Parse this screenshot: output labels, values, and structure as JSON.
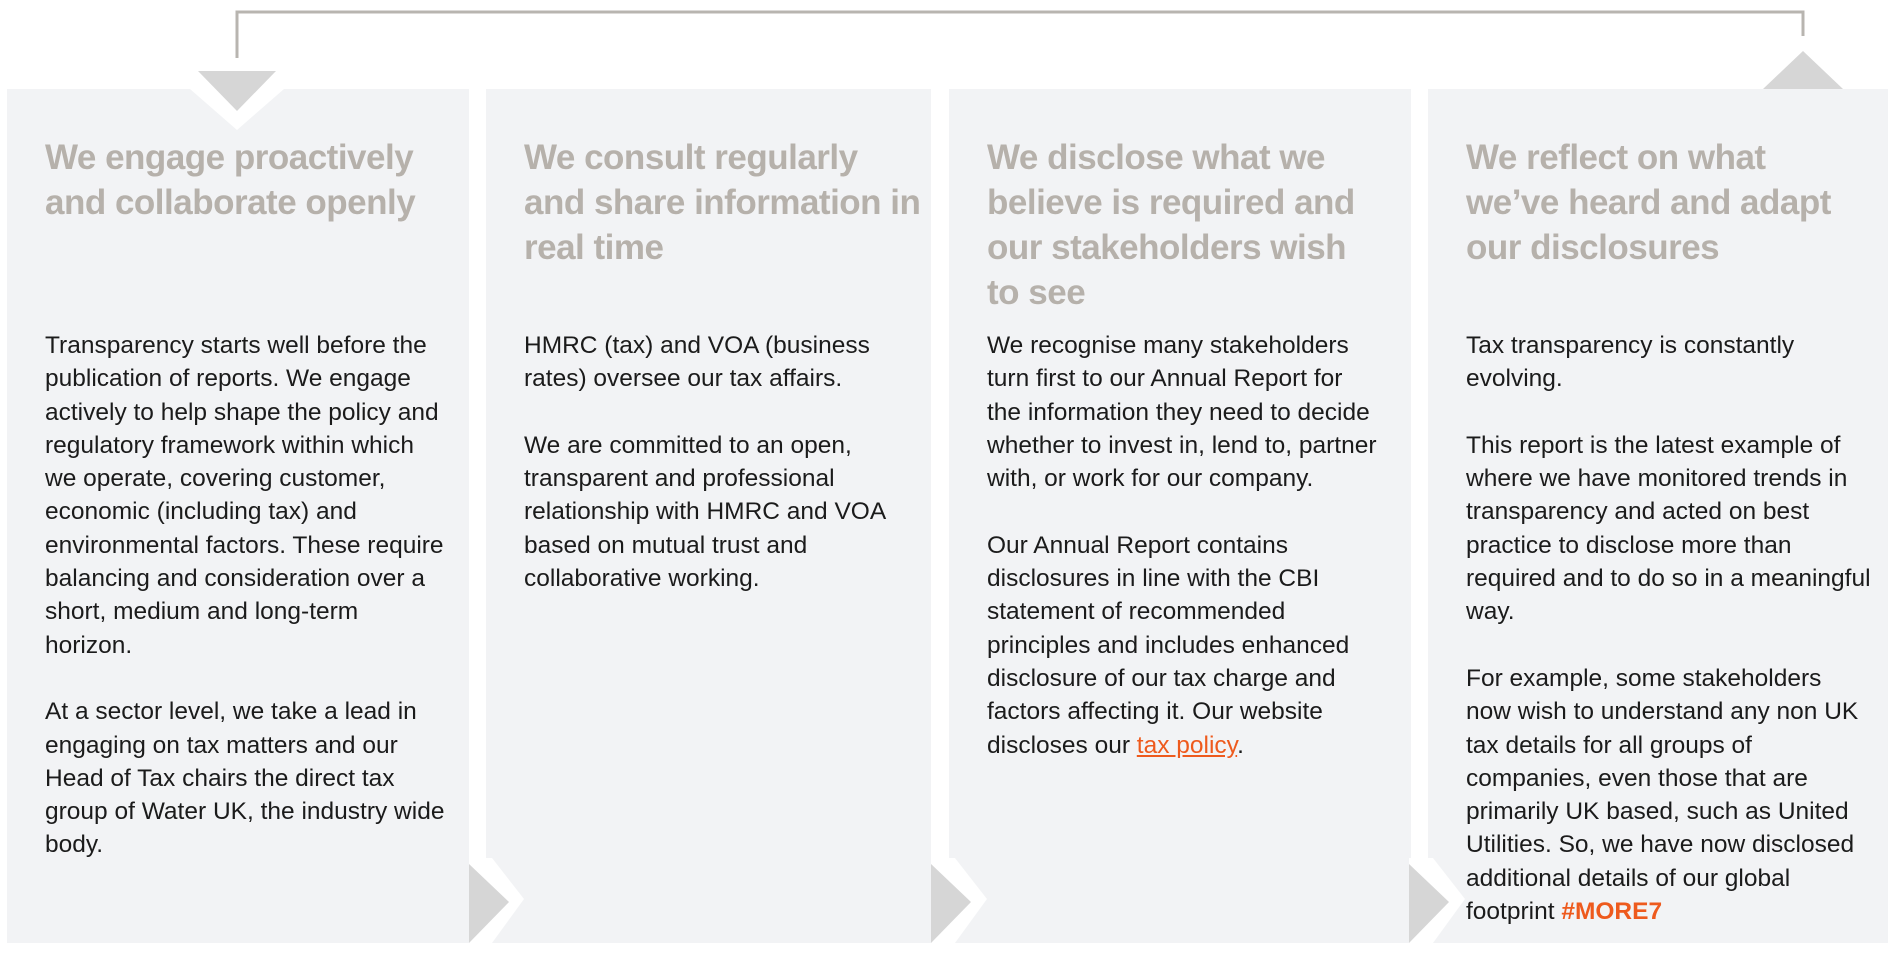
{
  "panels": [
    {
      "title": "We engage proactively and collaborate openly",
      "paragraphs": [
        "Transparency starts well before the publication of reports. We engage actively to help shape the policy and regulatory framework within which we operate, covering customer, economic (including tax) and environmental factors. These require balancing and consideration over a short, medium and long-term horizon.",
        "At a sector level, we take a lead in engaging on tax matters and our Head of Tax chairs the direct tax group of Water UK, the industry wide body."
      ]
    },
    {
      "title": "We consult regularly and share information in real time",
      "paragraphs": [
        "HMRC (tax) and VOA (business rates) oversee our tax affairs.",
        "We are committed to an open, transparent and professional relationship with HMRC and VOA based on mutual trust and collaborative working."
      ]
    },
    {
      "title": "We disclose what we believe is required and our stakeholders wish to see",
      "paragraphs": [
        "We recognise many stakeholders turn first to our Annual Report for the information they need to decide whether to invest in, lend to, partner with, or work for our company."
      ],
      "para2_text": "Our Annual Report contains disclosures in line with the CBI statement of recommended principles and includes enhanced disclosure of our tax charge and factors affecting it. Our website discloses our ",
      "para2_link": "tax policy",
      "para2_end": "."
    },
    {
      "title": "We reflect on what we’ve heard and adapt our disclosures",
      "paragraphs": [
        "Tax transparency is constantly evolving.",
        "This report is the latest example of where we have monitored trends in transparency and acted on best practice to disclose more than required and to do so in a meaningful way."
      ],
      "para3_text": "For example, some stakeholders now wish to understand any non UK tax details for all groups of companies, even those that are primarily UK based, such as United Utilities. So, we have now disclosed additional details of our global footprint ",
      "para3_tag": "#MORE7"
    }
  ],
  "colors": {
    "panel_bg": "#f2f3f5",
    "title": "#b6b1ab",
    "body_text": "#1b1b1b",
    "accent": "#ee5a1d",
    "connector": "#b8b5b0",
    "arrow_shape": "#d6d6d6"
  }
}
